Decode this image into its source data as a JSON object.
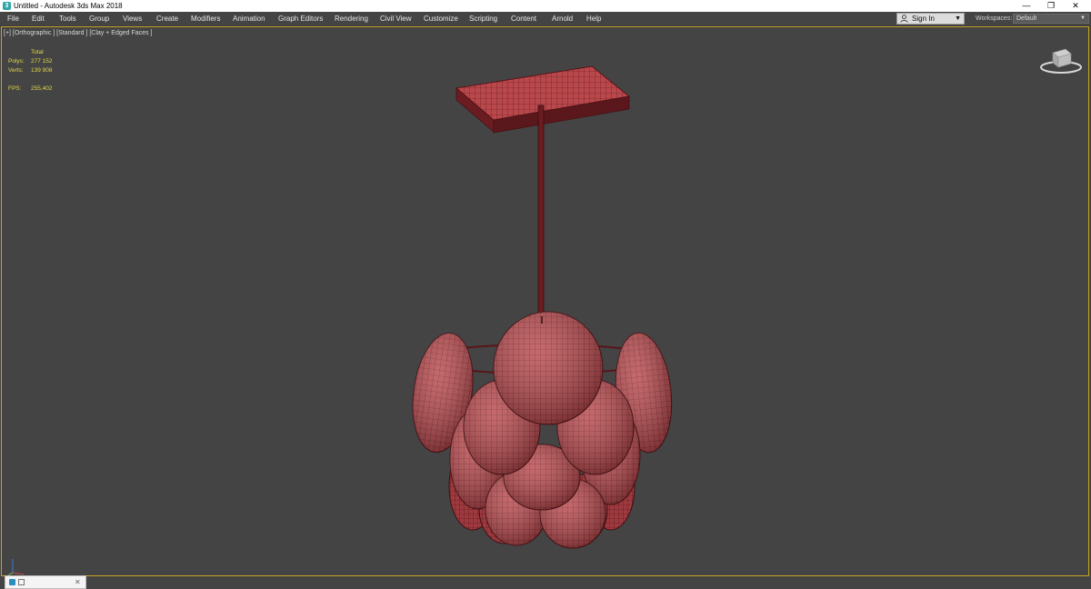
{
  "window": {
    "title": "Untitled - Autodesk 3ds Max 2018",
    "app_icon": "3",
    "minimize": "—",
    "restore": "❐",
    "close": "✕"
  },
  "menu": [
    "File",
    "Edit",
    "Tools",
    "Group",
    "Views",
    "Create",
    "Modifiers",
    "Animation",
    "Graph Editors",
    "Rendering",
    "Civil View",
    "Customize",
    "Scripting",
    "Content",
    "Arnold",
    "Help"
  ],
  "signin": {
    "label": "Sign In"
  },
  "workspaces": {
    "label": "Workspaces:",
    "value": "Default"
  },
  "viewport": {
    "label": "[+] [Orthographic ] [Standard ] [Clay + Edged Faces ]",
    "stats": {
      "total_label": "Total",
      "polys_label": "Polys:",
      "polys": "277 152",
      "verts_label": "Verts:",
      "verts": "139 908",
      "fps_label": "FPS:",
      "fps": "255,402"
    }
  },
  "mini_listener": {
    "close": "✕"
  },
  "colors": {
    "viewport_bg": "#444444",
    "viewport_border": "#c9a227",
    "stats_text": "#e2d84a",
    "model_fill": "#b9484c",
    "model_wire": "#5a1418"
  },
  "icons": {
    "app": "3dsmax-icon",
    "user": "user-icon",
    "viewcube": "viewcube-icon",
    "axis": "axis-tripod-icon"
  }
}
